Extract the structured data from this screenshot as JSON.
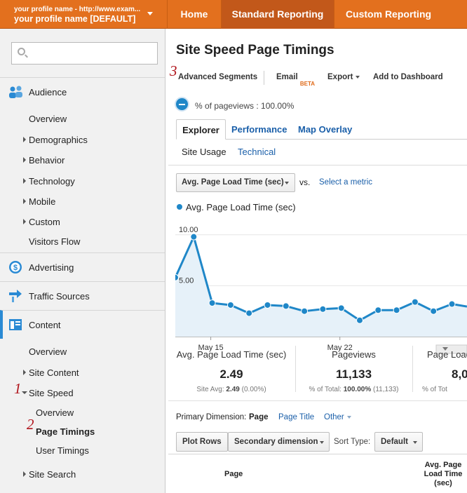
{
  "topbar": {
    "profile_line1": "your profile name - http://www.exam...",
    "profile_line2": "your profile name [DEFAULT]",
    "tabs": [
      "Home",
      "Standard Reporting",
      "Custom Reporting"
    ]
  },
  "sidebar": {
    "sections": {
      "audience": "Audience",
      "advertising": "Advertising",
      "traffic": "Traffic Sources",
      "content": "Content"
    },
    "audience_items": [
      "Overview",
      "Demographics",
      "Behavior",
      "Technology",
      "Mobile",
      "Custom",
      "Visitors Flow"
    ],
    "content_items": [
      "Overview",
      "Site Content",
      "Site Speed",
      "Site Search"
    ],
    "site_speed_items": [
      "Overview",
      "Page Timings",
      "User Timings"
    ],
    "markers": [
      "1",
      "2",
      "3"
    ]
  },
  "main": {
    "title": "Site Speed Page Timings",
    "actions": {
      "segments": "Advanced Segments",
      "email": "Email",
      "beta": "BETA",
      "export": "Export",
      "dashboard": "Add to Dashboard"
    },
    "segment_text": "% of pageviews : 100.00%",
    "tabs": [
      "Explorer",
      "Performance",
      "Map Overlay"
    ],
    "subtabs": [
      "Site Usage",
      "Technical"
    ],
    "metric_select": "Avg. Page Load Time (sec)",
    "vs": "vs.",
    "select_metric": "Select a metric",
    "legend": "Avg. Page Load Time (sec)",
    "scorecards": [
      {
        "label": "Avg. Page Load Time (sec)",
        "value": "2.49",
        "sub_prefix": "Site Avg: ",
        "sub_value": "2.49",
        "sub_suffix": " (0.00%)"
      },
      {
        "label": "Pageviews",
        "value": "11,133",
        "sub_prefix": "% of Total: ",
        "sub_value": "100.00%",
        "sub_suffix": " (11,133)"
      },
      {
        "label": "Page Load",
        "value": "8,0",
        "sub_prefix": "% of Tot",
        "sub_value": "",
        "sub_suffix": ""
      }
    ],
    "primary_dimension_label": "Primary Dimension:",
    "primary_dimension_items": [
      "Page",
      "Page Title",
      "Other"
    ],
    "plot_rows": "Plot Rows",
    "secondary_dimension": "Secondary dimension",
    "sort_type_label": "Sort Type:",
    "sort_type_value": "Default",
    "columns": {
      "page": "Page",
      "load": "Avg. Page Load Time (sec)"
    }
  },
  "colors": {
    "brand": "#e3701e",
    "accent": "#1f87c8",
    "link": "#1a5fa9"
  },
  "chart_data": {
    "type": "area",
    "series": [
      {
        "name": "Avg. Page Load Time (sec)",
        "values": [
          5.8,
          9.8,
          3.3,
          3.1,
          2.3,
          3.1,
          3.0,
          2.5,
          2.7,
          2.8,
          1.6,
          2.6,
          2.6,
          3.4,
          2.5,
          3.2,
          2.9
        ]
      }
    ],
    "x_ticks": [
      {
        "label": "May 15",
        "index": 2
      },
      {
        "label": "May 22",
        "index": 9
      }
    ],
    "y_ticks": [
      {
        "label": "10.00",
        "value": 10
      },
      {
        "label": "5.00",
        "value": 5
      }
    ],
    "ylim": [
      0,
      11.5
    ],
    "color": "#1f87c8",
    "fill": "#e6f1f9"
  }
}
